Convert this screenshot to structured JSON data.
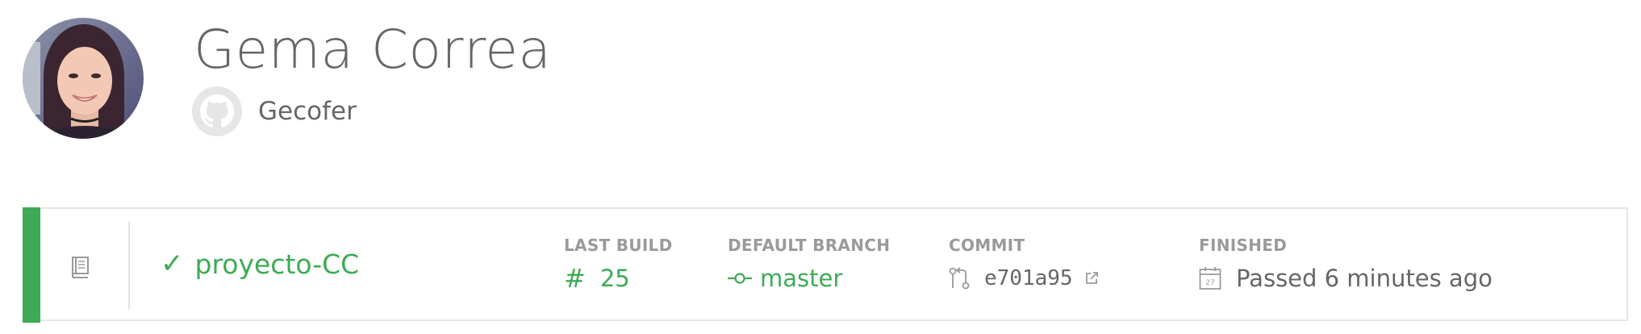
{
  "profile": {
    "name": "Gema Correa",
    "github_username": "Gecofer",
    "avatar_icon": "user-avatar-photo"
  },
  "repository": {
    "status": "passed",
    "status_color": "#3eaa56",
    "name": "proyecto-CC",
    "icon": "repo-icon",
    "last_build": {
      "label": "LAST BUILD",
      "number": "25",
      "icon": "hash-icon"
    },
    "default_branch": {
      "label": "DEFAULT BRANCH",
      "value": "master",
      "icon": "branch-icon"
    },
    "commit": {
      "label": "COMMIT",
      "value": "e701a95",
      "icon": "commit-icon",
      "external_icon": "external-link-icon"
    },
    "finished": {
      "label": "FINISHED",
      "value": "Passed 6 minutes ago",
      "icon": "calendar-icon"
    }
  },
  "colors": {
    "accent_green": "#3eaa56",
    "text_gray": "#666666",
    "label_gray": "#9a9a9a",
    "border_gray": "#e6e6e6"
  }
}
